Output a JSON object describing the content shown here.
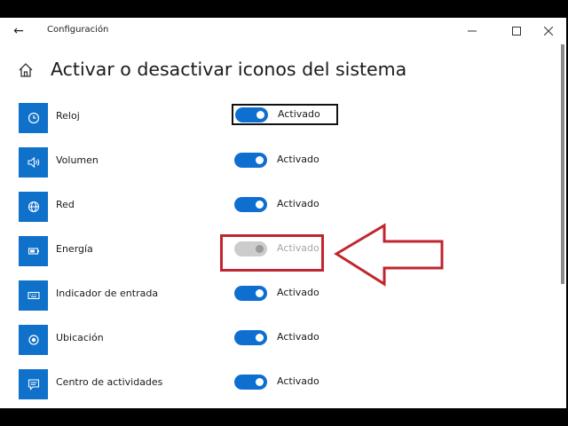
{
  "window": {
    "app_title": "Configuración",
    "back_icon": "arrow-left-icon",
    "controls": [
      "minimize-icon",
      "maximize-icon",
      "close-icon"
    ]
  },
  "header": {
    "home_icon": "home-icon",
    "title": "Activar o desactivar iconos del sistema"
  },
  "items": [
    {
      "label": "Reloj",
      "icon": "clock-icon",
      "state": "Activado",
      "on": true,
      "enabled": true,
      "focused": true
    },
    {
      "label": "Volumen",
      "icon": "volume-icon",
      "state": "Activado",
      "on": true,
      "enabled": true
    },
    {
      "label": "Red",
      "icon": "network-icon",
      "state": "Activado",
      "on": true,
      "enabled": true
    },
    {
      "label": "Energía",
      "icon": "battery-icon",
      "state": "Activado",
      "on": true,
      "enabled": false,
      "highlighted": true
    },
    {
      "label": "Indicador de entrada",
      "icon": "keyboard-icon",
      "state": "Activado",
      "on": true,
      "enabled": true
    },
    {
      "label": "Ubicación",
      "icon": "location-icon",
      "state": "Activado",
      "on": true,
      "enabled": true
    },
    {
      "label": "Centro de actividades",
      "icon": "action-center-icon",
      "state": "Activado",
      "on": true,
      "enabled": true
    }
  ],
  "annotation": {
    "color": "#c0262d",
    "shape": "arrow pointing left at Energía toggle"
  },
  "colors": {
    "accent": "#0f6fd0",
    "tile": "#0f71c9",
    "disabled": "#cccccc"
  }
}
